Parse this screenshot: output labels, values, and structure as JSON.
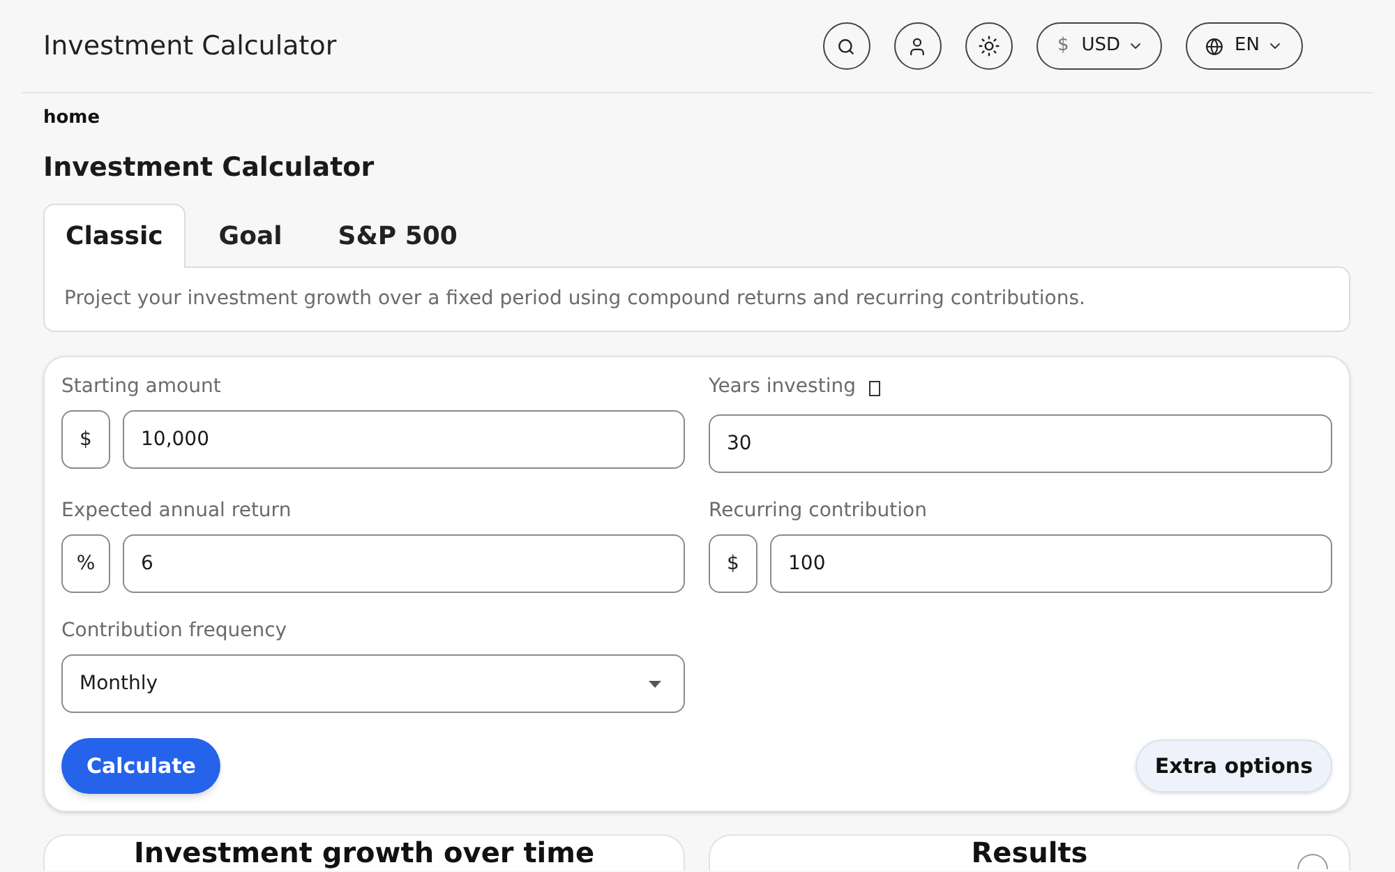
{
  "header": {
    "title": "Investment Calculator",
    "currency": {
      "symbol": "$",
      "code": "USD"
    },
    "language": "EN"
  },
  "breadcrumb": "home",
  "page_title": "Investment Calculator",
  "tabs": [
    {
      "label": "Classic",
      "selected": true
    },
    {
      "label": "Goal",
      "selected": false
    },
    {
      "label": "S&P 500",
      "selected": false
    }
  ],
  "tab_description": "Project your investment growth over a fixed period using compound returns and recurring contributions.",
  "form": {
    "fields": [
      {
        "label": "Starting amount",
        "kind": "input",
        "prefix": "$",
        "value": "10,000"
      },
      {
        "label": "Years investing",
        "kind": "input",
        "value": "30",
        "hint_icon": true
      },
      {
        "label": "Expected annual return",
        "kind": "input",
        "prefix": "%",
        "value": "6"
      },
      {
        "label": "Recurring contribution",
        "kind": "input",
        "prefix": "$",
        "value": "100"
      },
      {
        "label": "Contribution frequency",
        "kind": "select",
        "value": "Monthly"
      }
    ],
    "primary_button": "Calculate",
    "secondary_button": "Extra options"
  },
  "panels": [
    {
      "title": "Investment growth over time"
    },
    {
      "title": "Results",
      "corner_button": true
    }
  ]
}
